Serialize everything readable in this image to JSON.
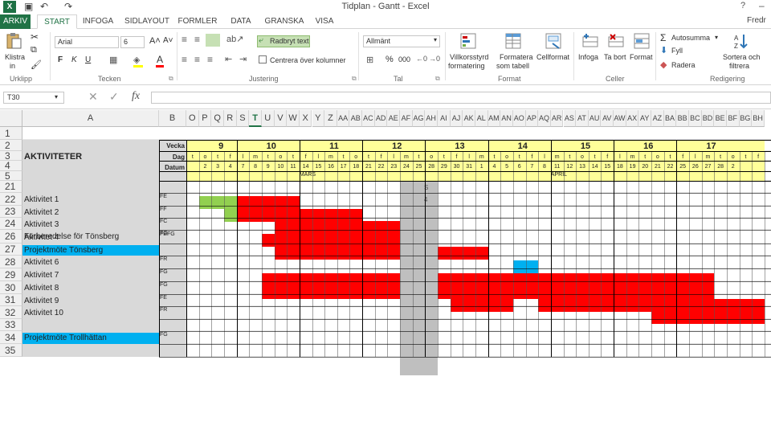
{
  "window": {
    "title": "Tidplan - Gantt - Excel",
    "help": "?",
    "user": "Fredr"
  },
  "ribbon": {
    "tabs": [
      {
        "label": "ARKIV",
        "type": "file"
      },
      {
        "label": "START",
        "type": "active"
      },
      {
        "label": "INFOGA"
      },
      {
        "label": "SIDLAYOUT"
      },
      {
        "label": "FORMLER"
      },
      {
        "label": "DATA"
      },
      {
        "label": "GRANSKA"
      },
      {
        "label": "VISA"
      }
    ],
    "clipboard": {
      "paste": "Klistra",
      "paste2": "in",
      "label": "Urklipp"
    },
    "font": {
      "name": "Arial",
      "size": "6",
      "bold": "F",
      "italic": "K",
      "underline": "U",
      "label": "Tecken"
    },
    "alignment": {
      "wrap": "Radbryt text",
      "merge": "Centrera över kolumner",
      "label": "Justering"
    },
    "number": {
      "format": "Allmänt",
      "percent": "%",
      "thousands": "000",
      "label": "Tal"
    },
    "styles": {
      "conditional": "Villkorsstyrd",
      "conditional2": "formatering",
      "table": "Formatera",
      "table2": "som tabell",
      "cell": "Cellformat",
      "label": "Format"
    },
    "cells": {
      "insert": "Infoga",
      "delete": "Ta bort",
      "format": "Format",
      "label": "Celler"
    },
    "editing": {
      "autosum": "Autosumma",
      "fill": "Fyll",
      "clear": "Radera",
      "sort": "Sortera och",
      "sort2": "filtrera",
      "label": "Redigering"
    }
  },
  "formula_bar": {
    "name_box": "T30",
    "cancel": "✕",
    "enter": "✓",
    "fx": "fx",
    "value": ""
  },
  "sheet": {
    "col_a_header": "A",
    "col_b_header": "B",
    "selected_column": "T",
    "columns": [
      "O",
      "P",
      "Q",
      "R",
      "S",
      "T",
      "U",
      "V",
      "W",
      "X",
      "Y",
      "Z",
      "AA",
      "AB",
      "AC",
      "AD",
      "AE",
      "AF",
      "AG",
      "AH",
      "AI",
      "AJ",
      "AK",
      "AL",
      "AM",
      "AN",
      "AO",
      "AP",
      "AQ",
      "AR",
      "AS",
      "AT",
      "AU",
      "AV",
      "AW",
      "AX",
      "AY",
      "AZ",
      "BA",
      "BB",
      "BC",
      "BD",
      "BE",
      "BF",
      "BG",
      "BH"
    ],
    "rows": [
      "1",
      "2",
      "3",
      "4",
      "5",
      "21",
      "22",
      "23",
      "24",
      "26",
      "27",
      "28",
      "29",
      "30",
      "31",
      "32",
      "33",
      "34",
      "35"
    ],
    "header_title": "AKTIVITETER",
    "labels": {
      "vecka": "Vecka",
      "dag": "Dag",
      "datum": "Datum"
    },
    "weeks": [
      "9",
      "10",
      "11",
      "12",
      "13",
      "14",
      "15",
      "16",
      "17"
    ],
    "day_letters": [
      "t",
      "o",
      "t",
      "f",
      "l",
      "m",
      "t",
      "o",
      "t",
      "f",
      "l",
      "m",
      "t",
      "o",
      "t",
      "f",
      "l",
      "m",
      "t",
      "o",
      "t",
      "f",
      "l",
      "m",
      "t",
      "o",
      "t",
      "f",
      "l",
      "m",
      "t",
      "o",
      "t",
      "f",
      "l",
      "m",
      "t",
      "o",
      "t",
      "f",
      "l",
      "m",
      "t",
      "o",
      "t",
      "f"
    ],
    "dates": [
      "",
      "2",
      "3",
      "4",
      "7",
      "8",
      "9",
      "10",
      "11",
      "14",
      "15",
      "16",
      "17",
      "18",
      "21",
      "22",
      "23",
      "24",
      "25",
      "28",
      "29",
      "30",
      "31",
      "1",
      "4",
      "5",
      "6",
      "7",
      "8",
      "11",
      "12",
      "13",
      "14",
      "15",
      "18",
      "19",
      "20",
      "21",
      "22",
      "25",
      "26",
      "27",
      "28",
      "2",
      "",
      ""
    ],
    "months": {
      "march": "MARS",
      "april": "APRIL"
    },
    "shaded_marks": {
      "top": "S",
      "second": "4"
    },
    "activities": [
      {
        "row": "22",
        "name": "Aktivitet 1",
        "who": "FE",
        "highlight": false
      },
      {
        "row": "23",
        "name": "Aktivitet 2",
        "who": "FF",
        "highlight": false
      },
      {
        "row": "24",
        "name": "Aktivitet 3",
        "who": "FC",
        "highlight": false
      },
      {
        "row": "26",
        "name": "Aktivitet 4",
        "who": "FG",
        "highlight": false
      },
      {
        "row": "27",
        "name": "Förberedelse för Tönsberg",
        "who": "FEFG",
        "highlight": false
      },
      {
        "row": "27b",
        "name": "Projektmöte Tönsberg",
        "who": "",
        "highlight": true
      },
      {
        "row": "28",
        "name": "Aktivitet 6",
        "who": "FR",
        "highlight": false
      },
      {
        "row": "29",
        "name": "Aktivitet 7",
        "who": "FG",
        "highlight": false
      },
      {
        "row": "30",
        "name": "Aktivitet 8",
        "who": "FG",
        "highlight": false
      },
      {
        "row": "31",
        "name": "Aktivitet 9",
        "who": "FE",
        "highlight": false
      },
      {
        "row": "32",
        "name": "Aktivitet 10",
        "who": "FR",
        "highlight": false
      },
      {
        "row": "33",
        "name": "",
        "who": "",
        "highlight": false
      },
      {
        "row": "34",
        "name": "Projektmöte Trollhättan",
        "who": "FG",
        "highlight": true
      },
      {
        "row": "35",
        "name": "",
        "who": "",
        "highlight": false
      }
    ],
    "colors": {
      "red": "#ff0000",
      "green": "#92d050",
      "blue": "#00b0f0",
      "yellow": "#ffff99",
      "grey": "#bfbfbf",
      "label_bg": "#d9d9d9"
    }
  }
}
